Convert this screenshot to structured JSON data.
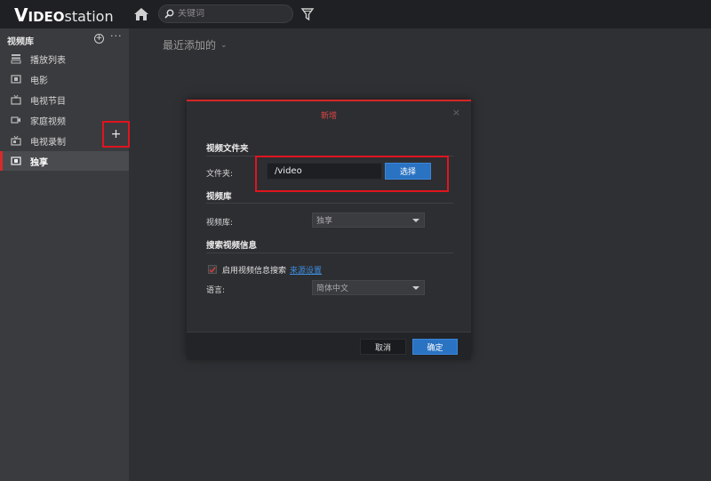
{
  "app": {
    "logo_v": "V",
    "logo_ideo": "IDEO",
    "logo_station": "station"
  },
  "toolbar": {
    "search_placeholder": "关键词",
    "home_icon": "home-icon",
    "filter_icon": "filter-icon"
  },
  "sidebar": {
    "header": "视频库",
    "add_label": "+",
    "more_label": "···",
    "items": [
      {
        "label": "播放列表",
        "icon": "playlist-icon"
      },
      {
        "label": "电影",
        "icon": "film-icon"
      },
      {
        "label": "电视节目",
        "icon": "tv-icon"
      },
      {
        "label": "家庭视频",
        "icon": "camera-icon"
      },
      {
        "label": "电视录制",
        "icon": "tv-record-icon"
      },
      {
        "label": "独享",
        "icon": "film-icon"
      }
    ],
    "active_plus": "+"
  },
  "main": {
    "title": "最近添加的",
    "chevron": "⌄"
  },
  "dialog": {
    "title": "新增",
    "close": "×",
    "section_folder": "视频文件夹",
    "folder_label": "文件夹:",
    "folder_value": "/video",
    "select_button": "选择",
    "section_library": "视频库",
    "library_label": "视频库:",
    "library_value": "独享",
    "section_search": "搜索视频信息",
    "enable_search": "启用视频信息搜索",
    "source_settings": "来源设置",
    "language_label": "语言:",
    "language_value": "简体中文",
    "cancel": "取消",
    "ok": "确定"
  },
  "colors": {
    "accent_red": "#d52626",
    "button_blue": "#2a73c2",
    "annotation_red": "#e0141e"
  }
}
